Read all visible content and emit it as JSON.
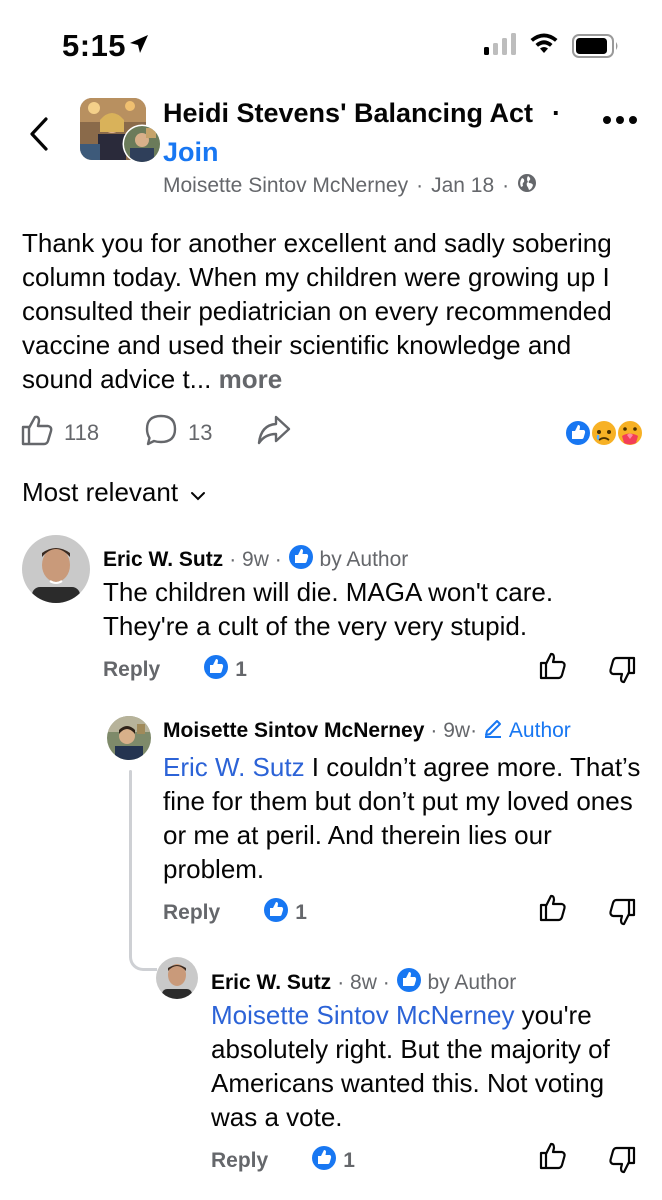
{
  "status_bar": {
    "time": "5:15"
  },
  "header": {
    "group_name": "Heidi Stevens' Balancing Act",
    "separator": "·",
    "join_label": "Join",
    "author": "Moisette Sintov McNerney",
    "date": "Jan 18",
    "dot": "·"
  },
  "post": {
    "text": "Thank you for another excellent and sadly sobering column today. When my children were growing up I consulted their pediatrician on every recommended vaccine and used their scientific knowledge and sound advice t...",
    "more_label": "more",
    "like_count": "118",
    "comment_count": "13"
  },
  "sort": {
    "label": "Most relevant"
  },
  "comments": [
    {
      "name": "Eric W. Sutz",
      "time": "9w",
      "badge": "by Author",
      "body": "The children will die. MAGA won't care. They're a cult of the very very stupid.",
      "reply_label": "Reply",
      "likes": "1"
    },
    {
      "name": "Moisette Sintov McNerney",
      "time": "9w",
      "badge": "Author",
      "mention": "Eric W. Sutz",
      "body": " I couldn’t agree more. That’s fine for them but don’t put my loved ones or me at peril. And therein lies our problem.",
      "reply_label": "Reply",
      "likes": "1"
    },
    {
      "name": "Eric W. Sutz",
      "time": "8w",
      "badge": "by Author",
      "mention": "Moisette Sintov McNerney",
      "body": " you're absolutely right. But the majority of Americans wanted this. Not voting was a vote.",
      "reply_label": "Reply",
      "likes": "1"
    }
  ],
  "colors": {
    "accent": "#1877f2",
    "mention": "#2c63d7",
    "secondary_text": "#65676b"
  }
}
